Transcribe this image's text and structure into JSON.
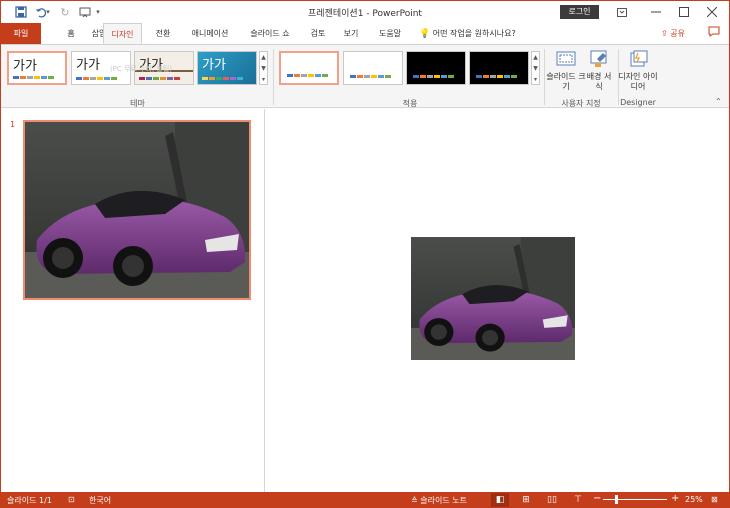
{
  "titlebar": {
    "title": "프레젠테이션1  -  PowerPoint",
    "login": "로그인"
  },
  "tabs": [
    {
      "label": "파일"
    },
    {
      "label": "홈"
    },
    {
      "label": "삽입"
    },
    {
      "label": "디자인"
    },
    {
      "label": "전환"
    },
    {
      "label": "애니메이션"
    },
    {
      "label": "슬라이드 쇼"
    },
    {
      "label": "검토"
    },
    {
      "label": "보기"
    },
    {
      "label": "도움말"
    }
  ],
  "tell_me": "어떤 작업을 원하시나요?",
  "share": "공유",
  "ribbon": {
    "themes": [
      {
        "label": "가가"
      },
      {
        "label": "가가"
      },
      {
        "label": "가가"
      },
      {
        "label": "가가"
      }
    ],
    "theme_group": "테마",
    "variant_group": "적용",
    "customize_group": "사용자 지정",
    "designer_group": "Designer",
    "slide_size": "슬라이드 크기",
    "format_bg": "배경 서식",
    "design_ideas": "디자인 아이디어",
    "watermark": "(PC 무료 수리, 불팁)"
  },
  "thumbnails": [
    {
      "number": "1"
    }
  ],
  "status": {
    "slide": "슬라이드 1/1",
    "language": "한국어",
    "notes": "슬라이드 노트",
    "zoom": "25%",
    "zoom_fraction": 0.2
  },
  "colors": {
    "accent": "#c43e1c",
    "car": "#7a3f8a"
  }
}
